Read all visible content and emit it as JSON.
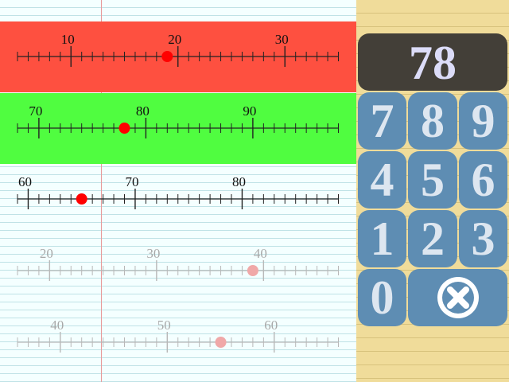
{
  "number_lines": [
    {
      "labels": [
        "10",
        "20",
        "30"
      ],
      "answer": 19,
      "tick_min": 5,
      "tick_max": 35,
      "status": "incorrect"
    },
    {
      "labels": [
        "70",
        "80",
        "90"
      ],
      "answer": 78,
      "tick_min": 68,
      "tick_max": 98,
      "status": "correct"
    },
    {
      "labels": [
        "60",
        "70",
        "80"
      ],
      "answer": 65,
      "tick_min": 59,
      "tick_max": 89,
      "status": "active"
    },
    {
      "labels": [
        "20",
        "30",
        "40"
      ],
      "answer": 39,
      "tick_min": 17,
      "tick_max": 47,
      "status": "pending"
    },
    {
      "labels": [
        "40",
        "50",
        "60"
      ],
      "answer": 55,
      "tick_min": 36,
      "tick_max": 66,
      "status": "pending"
    }
  ],
  "keypad": {
    "display": "78",
    "keys": [
      "7",
      "8",
      "9",
      "4",
      "5",
      "6",
      "1",
      "2",
      "3",
      "0"
    ],
    "clear_icon": "clear-x-icon"
  },
  "colors": {
    "incorrect_band": "#fe5040",
    "correct_band": "#50fd40",
    "marker": "#ff0000",
    "pending_marker": "#f0a8a8",
    "keypad_button": "#5e8db3",
    "display_bg": "#433f38",
    "notepad_bg": "#f0dc9a",
    "paper_bg": "#f4ffff"
  }
}
